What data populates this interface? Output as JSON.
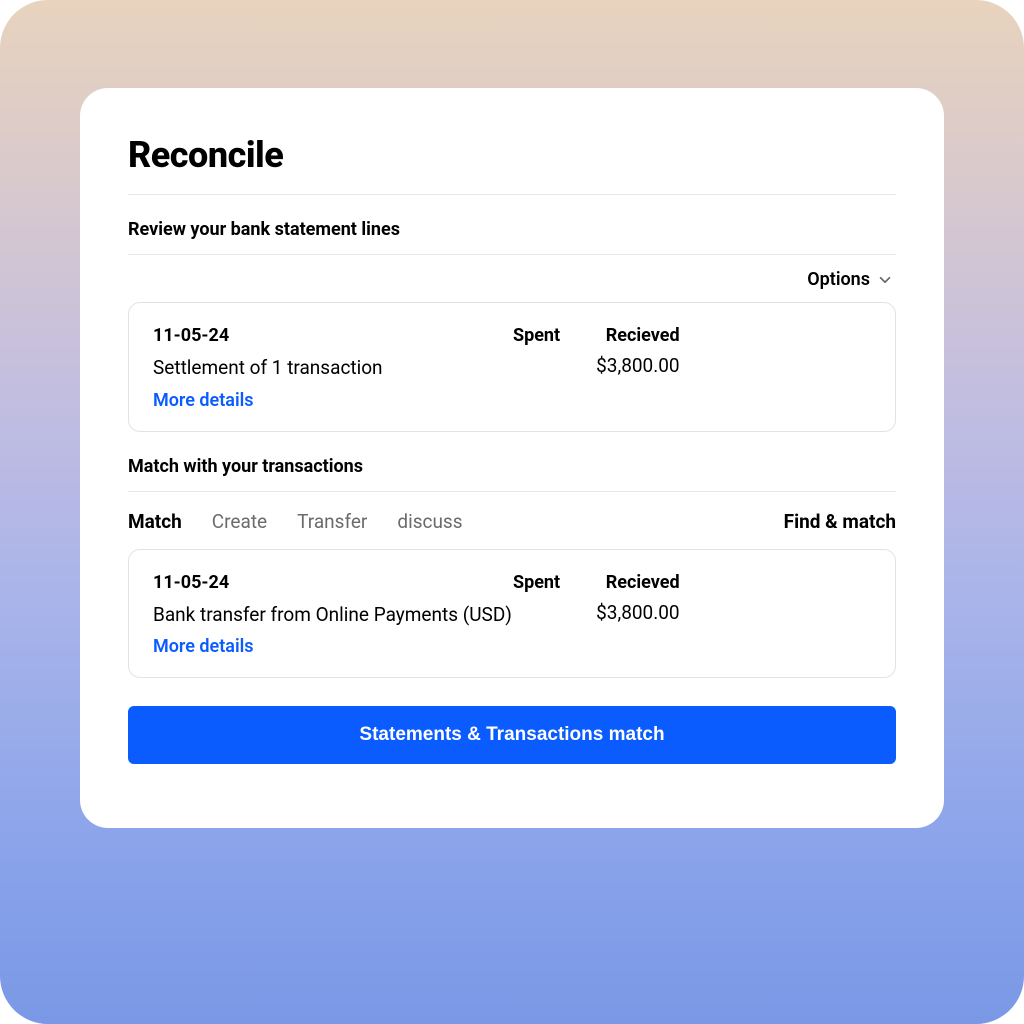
{
  "colors": {
    "accent": "#0B5CFF"
  },
  "page": {
    "title": "Reconcile"
  },
  "statements": {
    "section_label": "Review your bank statement lines",
    "options_label": "Options",
    "item": {
      "date": "11-05-24",
      "description": "Settlement of 1 transaction",
      "more_details": "More details",
      "spent_label": "Spent",
      "received_label": "Recieved",
      "spent_value": "",
      "received_value": "$3,800.00"
    }
  },
  "transactions": {
    "section_label": "Match with your transactions",
    "tabs": {
      "match": "Match",
      "create": "Create",
      "transfer": "Transfer",
      "discuss": "discuss"
    },
    "find_match": "Find & match",
    "item": {
      "date": "11-05-24",
      "description": "Bank transfer from Online Payments (USD)",
      "more_details": "More details",
      "spent_label": "Spent",
      "received_label": "Recieved",
      "spent_value": "",
      "received_value": "$3,800.00"
    }
  },
  "cta": {
    "label": "Statements & Transactions match"
  }
}
